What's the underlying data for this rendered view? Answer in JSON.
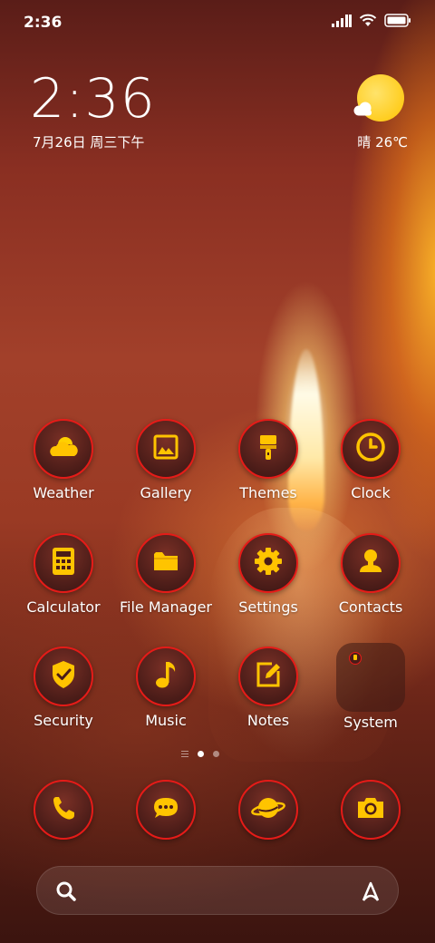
{
  "status_bar": {
    "time": "2:36",
    "icons": [
      "signal-icon",
      "wifi-icon",
      "battery-icon"
    ]
  },
  "clock_widget": {
    "time": "2:36",
    "date": "7月26日 周三下午"
  },
  "weather_widget": {
    "icon": "sunny-cloud-icon",
    "text": "晴 26℃"
  },
  "apps": [
    {
      "label": "Weather",
      "icon": "weather-icon"
    },
    {
      "label": "Gallery",
      "icon": "gallery-icon"
    },
    {
      "label": "Themes",
      "icon": "themes-brush-icon"
    },
    {
      "label": "Clock",
      "icon": "clock-icon"
    },
    {
      "label": "Calculator",
      "icon": "calculator-icon"
    },
    {
      "label": "File Manager",
      "icon": "folder-icon"
    },
    {
      "label": "Settings",
      "icon": "gear-icon"
    },
    {
      "label": "Contacts",
      "icon": "contact-icon"
    },
    {
      "label": "Security",
      "icon": "shield-icon"
    },
    {
      "label": "Music",
      "icon": "music-note-icon"
    },
    {
      "label": "Notes",
      "icon": "notes-pencil-icon"
    },
    {
      "label": "System",
      "icon": "folder-group-icon"
    }
  ],
  "page_indicator": {
    "pages": 2,
    "active": 1
  },
  "dock": [
    {
      "icon": "phone-icon"
    },
    {
      "icon": "message-icon"
    },
    {
      "icon": "browser-planet-icon"
    },
    {
      "icon": "camera-icon"
    }
  ],
  "search_bar": {
    "left_icon": "search-icon",
    "right_icon": "assistant-icon"
  },
  "colors": {
    "icon_glyph": "#ffc400",
    "icon_ring": "#e51b18",
    "icon_bg": "#4a1c18"
  }
}
